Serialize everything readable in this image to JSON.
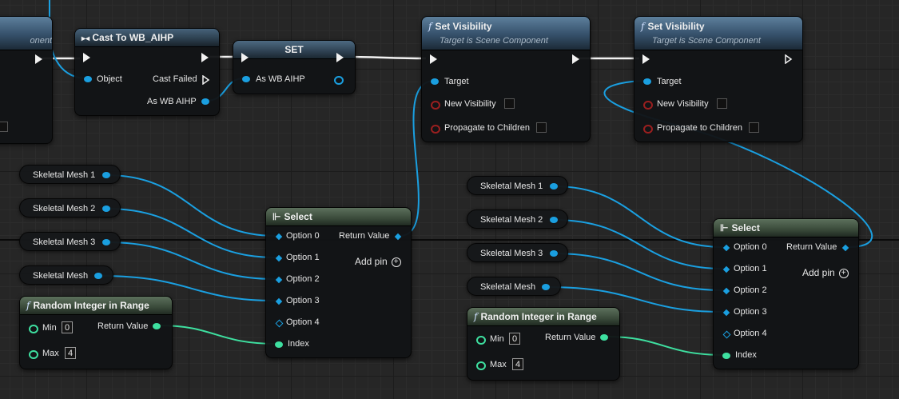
{
  "cut_node": {
    "title_fragment": "onent"
  },
  "cast_node": {
    "title": "Cast To WB_AIHP",
    "pins": {
      "object": "Object",
      "cast_failed": "Cast Failed",
      "as_wb": "As WB AIHP"
    }
  },
  "set_node": {
    "title": "SET",
    "pin": "As WB AIHP"
  },
  "set_visibility_1": {
    "title": "Set Visibility",
    "subtitle": "Target is Scene Component",
    "pins": {
      "target": "Target",
      "new_visibility": "New Visibility",
      "propagate": "Propagate to Children"
    }
  },
  "set_visibility_2": {
    "title": "Set Visibility",
    "subtitle": "Target is Scene Component",
    "pins": {
      "target": "Target",
      "new_visibility": "New Visibility",
      "propagate": "Propagate to Children"
    }
  },
  "left_vars": [
    "Skeletal Mesh 1",
    "Skeletal Mesh 2",
    "Skeletal Mesh 3",
    "Skeletal Mesh"
  ],
  "right_vars": [
    "Skeletal Mesh 1",
    "Skeletal Mesh 2",
    "Skeletal Mesh 3",
    "Skeletal Mesh"
  ],
  "select_1": {
    "title": "Select",
    "options": [
      "Option 0",
      "Option 1",
      "Option 2",
      "Option 3",
      "Option 4"
    ],
    "index": "Index",
    "return_value": "Return Value",
    "add_pin": "Add pin"
  },
  "select_2": {
    "title": "Select",
    "options": [
      "Option 0",
      "Option 1",
      "Option 2",
      "Option 3",
      "Option 4"
    ],
    "index": "Index",
    "return_value": "Return Value",
    "add_pin": "Add pin"
  },
  "random_1": {
    "title": "Random Integer in Range",
    "min_label": "Min",
    "min": "0",
    "max_label": "Max",
    "max": "4",
    "return_value": "Return Value"
  },
  "random_2": {
    "title": "Random Integer in Range",
    "min_label": "Min",
    "min": "0",
    "max_label": "Max",
    "max": "4",
    "return_value": "Return Value"
  },
  "colors": {
    "object_pin": "#1a9fe0",
    "integer_pin": "#3ee0a0",
    "bool_pin": "#9a1f1f",
    "exec_wire": "#f2f2f2"
  }
}
